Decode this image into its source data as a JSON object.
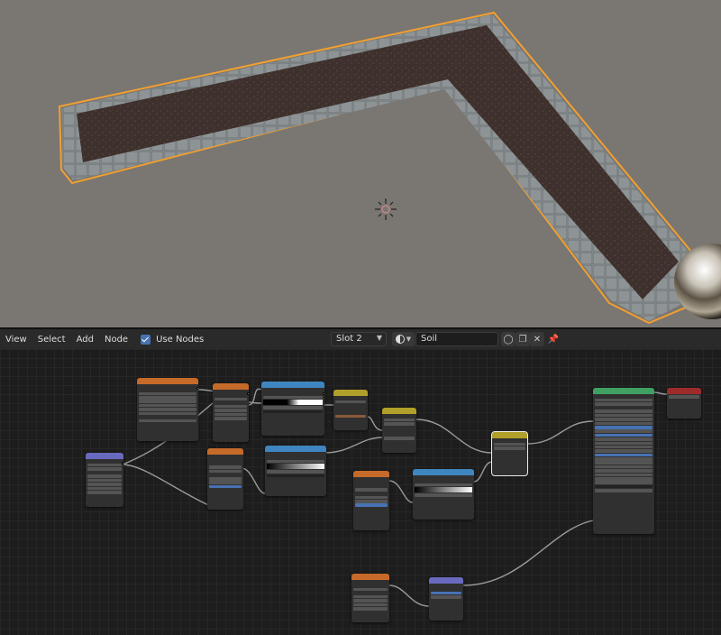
{
  "header": {
    "menus": [
      "View",
      "Select",
      "Add",
      "Node"
    ],
    "use_nodes_label": "Use Nodes",
    "slot": "Slot 2",
    "material_name": "Soil"
  },
  "icons": [
    "shield-icon",
    "duplicate-icon",
    "close-icon",
    "pin-icon",
    "material-sphere-icon",
    "chevron-down-icon",
    "checkbox-icon",
    "light-gizmo-icon",
    "world-sphere-icon"
  ],
  "colors": {
    "viewport_bg": "#7a7672",
    "soil": "#3e302c",
    "border_stone": "#8e9496",
    "selection_outline": "#f0a030",
    "node_editor_bg": "#1d1d1d",
    "header_texture": "#c66a2a",
    "header_converter": "#3f86c0",
    "header_vector": "#6969c0",
    "header_mix": "#b0a02a",
    "header_shader": "#3fa061",
    "header_output": "#9e2b2b"
  }
}
